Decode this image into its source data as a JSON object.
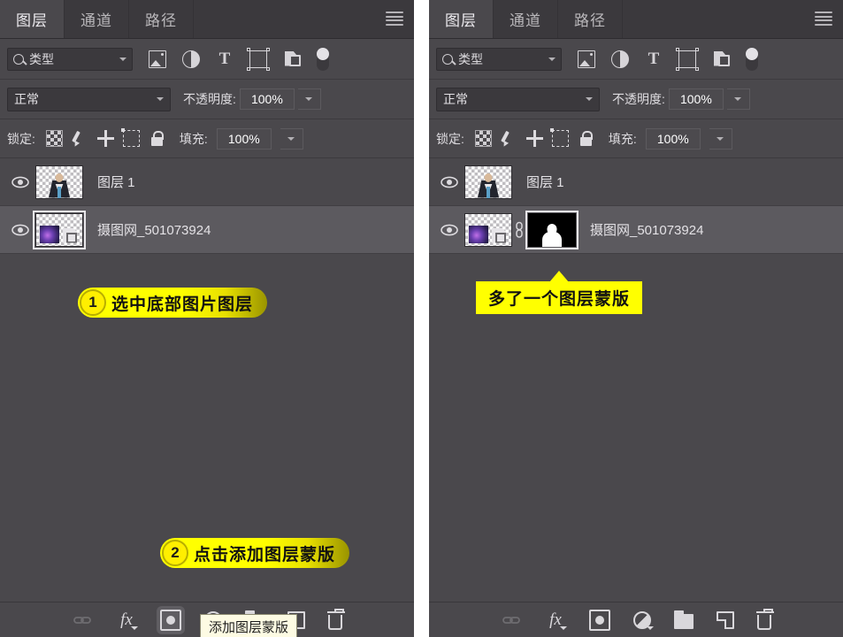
{
  "panels": [
    {
      "id": "left",
      "tabs": [
        {
          "label": "图层",
          "active": true
        },
        {
          "label": "通道",
          "active": false
        },
        {
          "label": "路径",
          "active": false
        }
      ],
      "filter": {
        "type_label": "类型",
        "icons": [
          "image-filter-icon",
          "adjustment-filter-icon",
          "type-filter-icon",
          "shape-filter-icon",
          "smart-object-filter-icon",
          "filter-toggle-switch"
        ]
      },
      "blend": {
        "mode": "正常",
        "opacity_label": "不透明度:",
        "opacity_value": "100%"
      },
      "lock": {
        "label": "锁定:",
        "icons": [
          "lock-transparency-icon",
          "lock-image-icon",
          "lock-position-icon",
          "lock-artboard-icon",
          "lock-all-icon"
        ],
        "fill_label": "填充:",
        "fill_value": "100%"
      },
      "layers": [
        {
          "name": "图层 1",
          "visible": true,
          "selected": false,
          "thumb": "person-thumbnail",
          "has_mask": false
        },
        {
          "name": "摄图网_501073924",
          "visible": true,
          "selected": true,
          "thumb": "galaxy-thumbnail",
          "has_mask": false
        }
      ],
      "callouts": [
        {
          "kind": "pill",
          "number": "1",
          "text": "选中底部图片图层"
        },
        {
          "kind": "pill",
          "number": "2",
          "text": "点击添加图层蒙版"
        }
      ],
      "tooltip": "添加图层蒙版",
      "bottom_icons": [
        "link-layers-icon",
        "layer-style-fx-icon",
        "add-layer-mask-icon",
        "new-adjustment-layer-icon",
        "new-group-icon",
        "new-layer-icon",
        "delete-layer-icon"
      ],
      "highlighted_bottom_icon": "add-layer-mask-icon"
    },
    {
      "id": "right",
      "tabs": [
        {
          "label": "图层",
          "active": true
        },
        {
          "label": "通道",
          "active": false
        },
        {
          "label": "路径",
          "active": false
        }
      ],
      "filter": {
        "type_label": "类型",
        "icons": [
          "image-filter-icon",
          "adjustment-filter-icon",
          "type-filter-icon",
          "shape-filter-icon",
          "smart-object-filter-icon",
          "filter-toggle-switch"
        ]
      },
      "blend": {
        "mode": "正常",
        "opacity_label": "不透明度:",
        "opacity_value": "100%"
      },
      "lock": {
        "label": "锁定:",
        "icons": [
          "lock-transparency-icon",
          "lock-image-icon",
          "lock-position-icon",
          "lock-artboard-icon",
          "lock-all-icon"
        ],
        "fill_label": "填充:",
        "fill_value": "100%"
      },
      "layers": [
        {
          "name": "图层 1",
          "visible": true,
          "selected": false,
          "thumb": "person-thumbnail",
          "has_mask": false
        },
        {
          "name": "摄图网_501073924",
          "visible": true,
          "selected": true,
          "thumb": "galaxy-thumbnail",
          "has_mask": true
        }
      ],
      "callouts": [
        {
          "kind": "flat",
          "text": "多了一个图层蒙版"
        }
      ],
      "bottom_icons": [
        "link-layers-icon",
        "layer-style-fx-icon",
        "add-layer-mask-icon",
        "new-adjustment-layer-icon",
        "new-group-icon",
        "new-layer-icon",
        "delete-layer-icon"
      ]
    }
  ],
  "colors": {
    "panel_bg": "#4a484c",
    "tabbar_bg": "#3b393d",
    "selected_row": "#5c5a5f",
    "accent_yellow": "#ffff00",
    "tooltip_bg": "#fdfbe3"
  }
}
